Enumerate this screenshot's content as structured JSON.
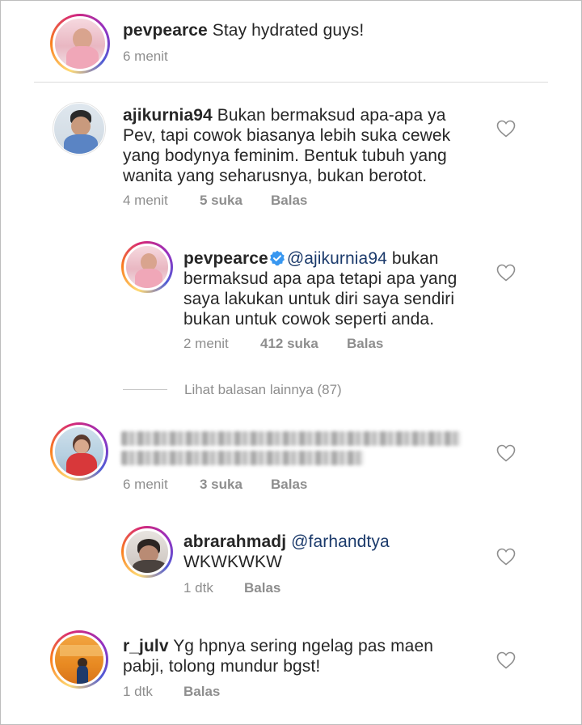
{
  "caption": {
    "username": "pevpearce",
    "text": "Stay hydrated guys!",
    "time": "6 menit"
  },
  "comments": [
    {
      "username": "ajikurnia94",
      "lines": [
        "Bukan bermaksud apa-apa ya",
        "Pev, tapi cowok biasanya lebih suka cewek",
        "yang bodynya feminim. Bentuk tubuh yang",
        "wanita yang seharusnya, bukan berotot."
      ],
      "time": "4 menit",
      "likes": "5 suka",
      "reply": "Balas"
    },
    {
      "username": "pevpearce",
      "verified": true,
      "mention": "@ajikurnia94",
      "lines": [
        "bukan",
        "bermaksud apa apa tetapi apa yang",
        "saya lakukan untuk diri saya sendiri",
        "bukan untuk cowok seperti anda."
      ],
      "time": "2 menit",
      "likes": "412 suka",
      "reply": "Balas"
    },
    {
      "view_more": "Lihat balasan lainnya (87)"
    },
    {
      "username": "",
      "blurred": true,
      "time": "6 menit",
      "likes": "3 suka",
      "reply": "Balas"
    },
    {
      "username": "abrarahmadj",
      "mention": "@farhandtya",
      "lines": [
        "WKWKWKW"
      ],
      "time": "1 dtk",
      "reply": "Balas"
    },
    {
      "username": "r_julv",
      "lines": [
        "Yg hpnya sering ngelag pas maen",
        "pabji, tolong mundur bgst!"
      ],
      "time": "1 dtk",
      "reply": "Balas"
    }
  ],
  "colors": {
    "text": "#262626",
    "meta": "#8e8e8e",
    "mention": "#1b3a6b",
    "verified": "#3897f0",
    "divider": "#dbdbdb"
  },
  "icons": {
    "like": "heart-outline-icon",
    "verified": "verified-badge-icon"
  }
}
